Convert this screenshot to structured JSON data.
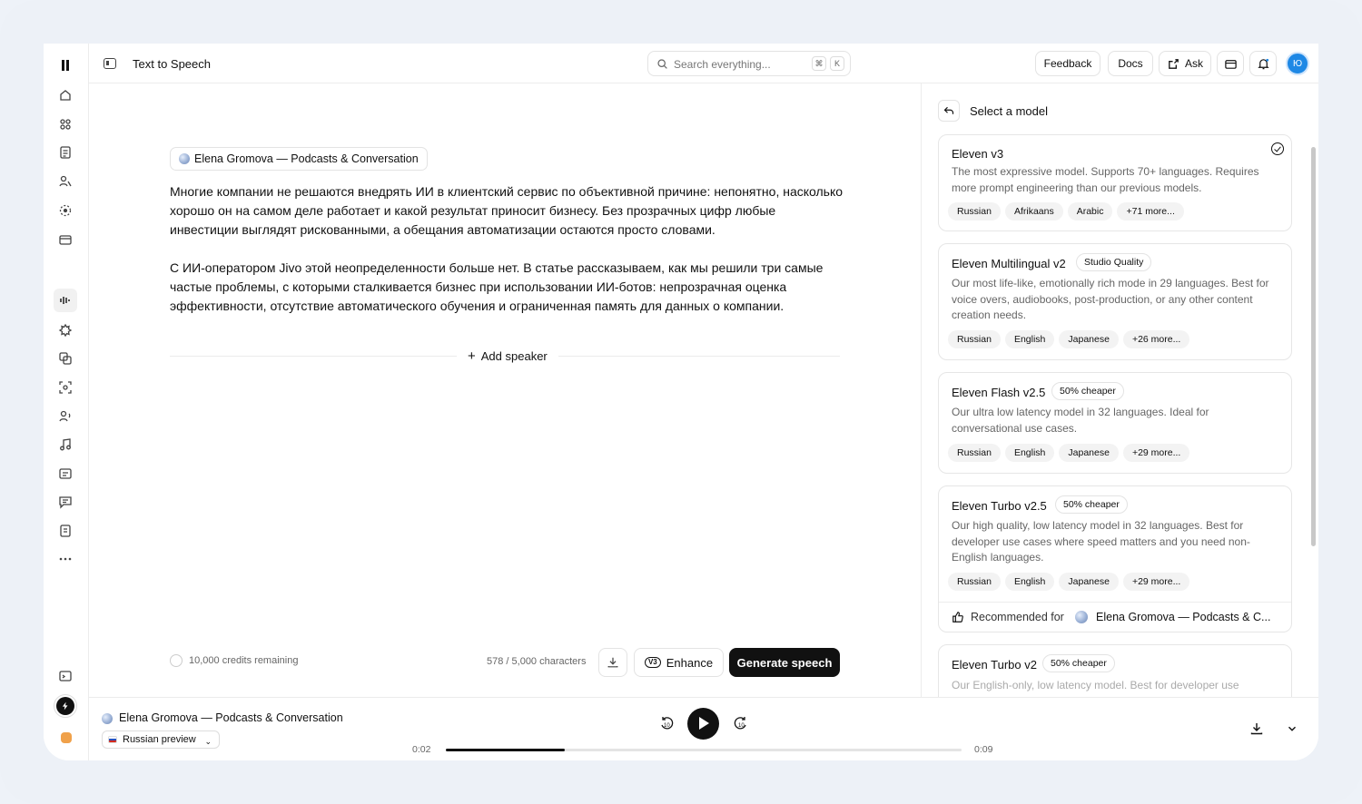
{
  "app": {
    "page_title": "Text to Speech"
  },
  "search": {
    "placeholder": "Search everything...",
    "shortcut_1": "⌘",
    "shortcut_2": "K"
  },
  "header": {
    "feedback": "Feedback",
    "docs": "Docs",
    "ask": "Ask",
    "avatar_initials": "Ю"
  },
  "editor": {
    "voice": "Elena Gromova — Podcasts & Conversation",
    "paragraph_1": "Многие компании не решаются внедрять ИИ в клиентский сервис по объективной причине: непонятно, насколько хорошо он на самом деле работает и какой результат приносит бизнесу. Без прозрачных цифр любые инвестиции выглядят рискованными, а обещания автоматизации остаются просто словами.",
    "paragraph_2": "С ИИ-оператором Jivo этой неопределенности больше нет. В статье рассказываем, как мы решили три самые частые проблемы, с которыми сталкивается бизнес при использовании ИИ-ботов: непрозрачная оценка эффективности, отсутствие автоматического обучения и ограниченная память для данных о компании.",
    "add_speaker": "Add speaker",
    "credits": "10,000 credits remaining",
    "characters": "578 / 5,000 characters",
    "enhance": "Enhance",
    "enhance_badge": "V3",
    "generate": "Generate speech"
  },
  "model_panel": {
    "title": "Select a model",
    "models": [
      {
        "name": "Eleven v3",
        "badge": "",
        "selected": true,
        "description": "The most expressive model. Supports 70+ languages. Requires more prompt engineering than our previous models.",
        "tags": [
          "Russian",
          "Afrikaans",
          "Arabic",
          "+71 more..."
        ]
      },
      {
        "name": "Eleven Multilingual v2",
        "badge": "Studio Quality",
        "selected": false,
        "description": "Our most life-like, emotionally rich mode in 29 languages. Best for voice overs, audiobooks, post-production, or any other content creation needs.",
        "tags": [
          "Russian",
          "English",
          "Japanese",
          "+26 more..."
        ]
      },
      {
        "name": "Eleven Flash v2.5",
        "badge": "50% cheaper",
        "selected": false,
        "description": "Our ultra low latency model in 32 languages. Ideal for conversational use cases.",
        "tags": [
          "Russian",
          "English",
          "Japanese",
          "+29 more..."
        ]
      },
      {
        "name": "Eleven Turbo v2.5",
        "badge": "50% cheaper",
        "selected": false,
        "description": "Our high quality, low latency model in 32 languages. Best for developer use cases where speed matters and you need non-English languages.",
        "tags": [
          "Russian",
          "English",
          "Japanese",
          "+29 more..."
        ],
        "recommended_label": "Recommended for",
        "recommended_voice": "Elena Gromova — Podcasts & C..."
      },
      {
        "name": "Eleven Turbo v2",
        "badge": "50% cheaper",
        "selected": false,
        "description": "Our English-only, low latency model. Best for developer use",
        "tags": []
      }
    ]
  },
  "player": {
    "voice": "Elena Gromova — Podcasts & Conversation",
    "language": "Russian preview",
    "current_time": "0:02",
    "total_time": "0:09",
    "progress": 0.23,
    "skip_back": "10",
    "skip_forward": "10"
  },
  "colors": {
    "primary": "#111111",
    "avatar": "#1e88e5",
    "muted_text": "#666666"
  }
}
